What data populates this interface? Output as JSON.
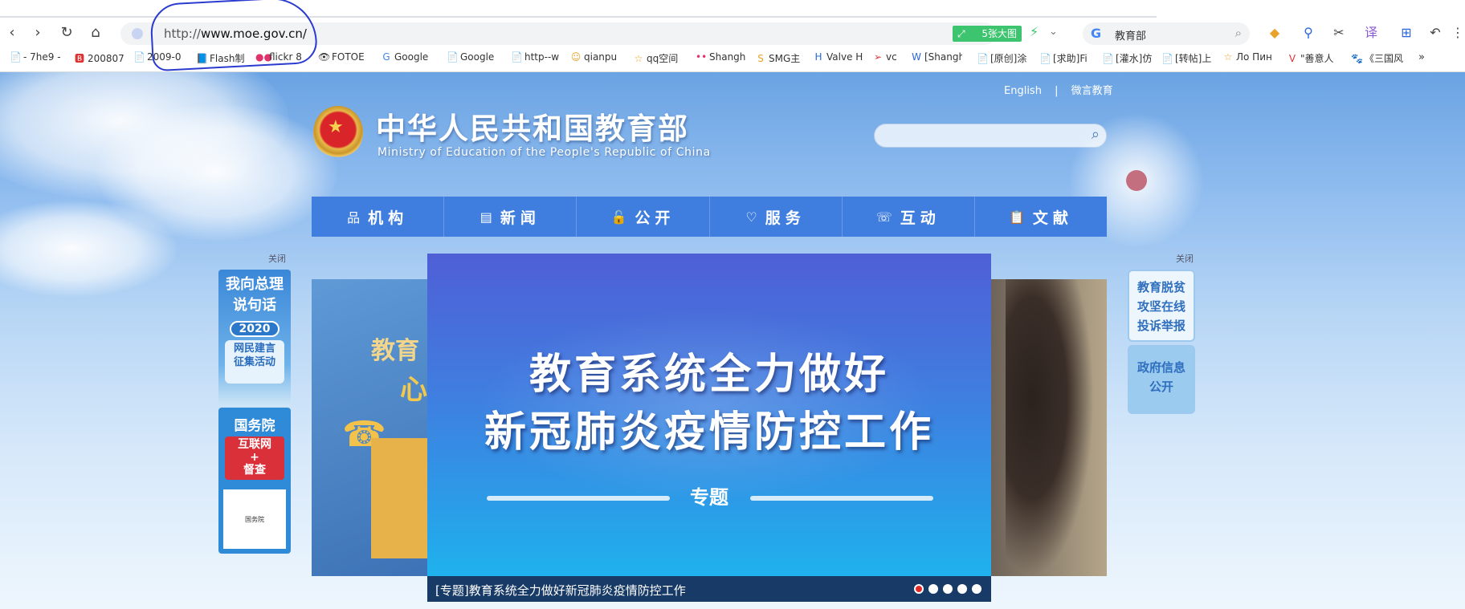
{
  "browser": {
    "url_prefix": "http://",
    "url_host": "www.moe.gov.cn/",
    "bigpic_label": "5张大图",
    "search_engine": "G",
    "search_text": "教育部",
    "bookmarks": [
      {
        "label": "- 7he9 -",
        "icon": "📄"
      },
      {
        "label": "200807",
        "icon": "🅱"
      },
      {
        "label": "2009-0",
        "icon": "📄"
      },
      {
        "label": "Flash制",
        "icon": "📘"
      },
      {
        "label": "flickr 8",
        "icon": "●●"
      },
      {
        "label": "FOTOE",
        "icon": "👁"
      },
      {
        "label": "Google",
        "icon": "G"
      },
      {
        "label": "Google",
        "icon": "📄"
      },
      {
        "label": "http--w",
        "icon": "📄"
      },
      {
        "label": "qianpu",
        "icon": "☺"
      },
      {
        "label": "qq空间",
        "icon": "☆"
      },
      {
        "label": "Shangh",
        "icon": "••"
      },
      {
        "label": "SMG主",
        "icon": "S"
      },
      {
        "label": "Valve H",
        "icon": "H"
      },
      {
        "label": "vc",
        "icon": "➢"
      },
      {
        "label": "[Shangh",
        "icon": "W"
      },
      {
        "label": "[原创]涂",
        "icon": "📄"
      },
      {
        "label": "[求助]Fi",
        "icon": "📄"
      },
      {
        "label": "[灌水]仿",
        "icon": "📄"
      },
      {
        "label": "[转帖]上",
        "icon": "📄"
      },
      {
        "label": "Ло Пин",
        "icon": "☆"
      },
      {
        "label": "\"善意人",
        "icon": "V"
      },
      {
        "label": "《三国风",
        "icon": "🐾"
      }
    ],
    "bookmarks_more": "»"
  },
  "site": {
    "toplinks": [
      "English",
      "|",
      "微言教育"
    ],
    "title": "中华人民共和国教育部",
    "subtitle": "Ministry of Education of the People's Republic of China",
    "nav": [
      {
        "label": "机构",
        "icon": "品"
      },
      {
        "label": "新闻",
        "icon": "▤"
      },
      {
        "label": "公开",
        "icon": "🔓"
      },
      {
        "label": "服务",
        "icon": "♡"
      },
      {
        "label": "互动",
        "icon": "☏"
      },
      {
        "label": "文献",
        "icon": "📋"
      }
    ],
    "close_label": "关闭",
    "left_ad": {
      "headline_line1": "我向总理",
      "headline_line2": "说句话",
      "year": "2020",
      "sub_line1": "网民建言",
      "sub_line2": "征集活动"
    },
    "left_ad2": {
      "title": "国务院",
      "red_line1": "互联网",
      "red_line2": "+",
      "red_line3": "督查",
      "qr_label": "国务院"
    },
    "right_ad1": {
      "line1": "教育脱贫",
      "line2": "攻坚在线",
      "line3": "投诉举报"
    },
    "right_ad2": {
      "line1": "政府信息",
      "line2": "公开"
    },
    "left_banner": {
      "text1": "教育",
      "text2": "心"
    },
    "slide": {
      "line1": "教育系统全力做好",
      "line2": "新冠肺炎疫情防控工作",
      "tag": "专题",
      "caption": "[专题]教育系统全力做好新冠肺炎疫情防控工作",
      "dot_count": 5,
      "active_dot": 0
    }
  }
}
